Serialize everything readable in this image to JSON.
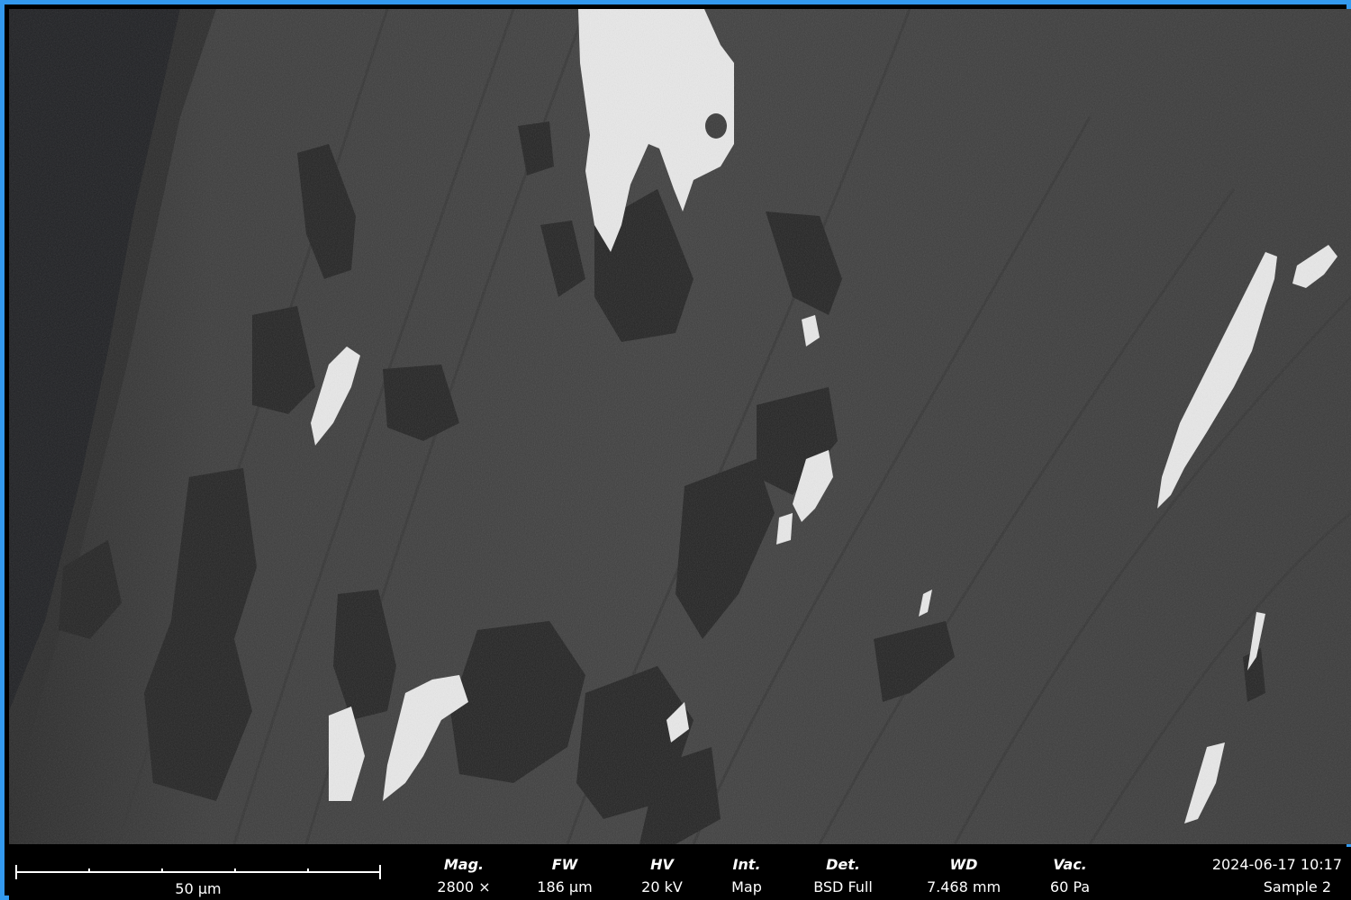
{
  "image": {
    "description_icon": "sem-backscatter-micrograph"
  },
  "colors": {
    "border": "#3399ee",
    "background": "#3a3a3a",
    "infobar": "#000000",
    "text": "#ffffff"
  },
  "scale_bar": {
    "label": "50 µm"
  },
  "params": [
    {
      "label": "Mag.",
      "value": "2800 ×"
    },
    {
      "label": "FW",
      "value": "186 µm"
    },
    {
      "label": "HV",
      "value": "20 kV"
    },
    {
      "label": "Int.",
      "value": "Map"
    },
    {
      "label": "Det.",
      "value": "BSD Full"
    },
    {
      "label": "WD",
      "value": "7.468 mm"
    },
    {
      "label": "Vac.",
      "value": "60 Pa"
    }
  ],
  "datetime": "2024-06-17 10:17",
  "sample": "Sample 2"
}
